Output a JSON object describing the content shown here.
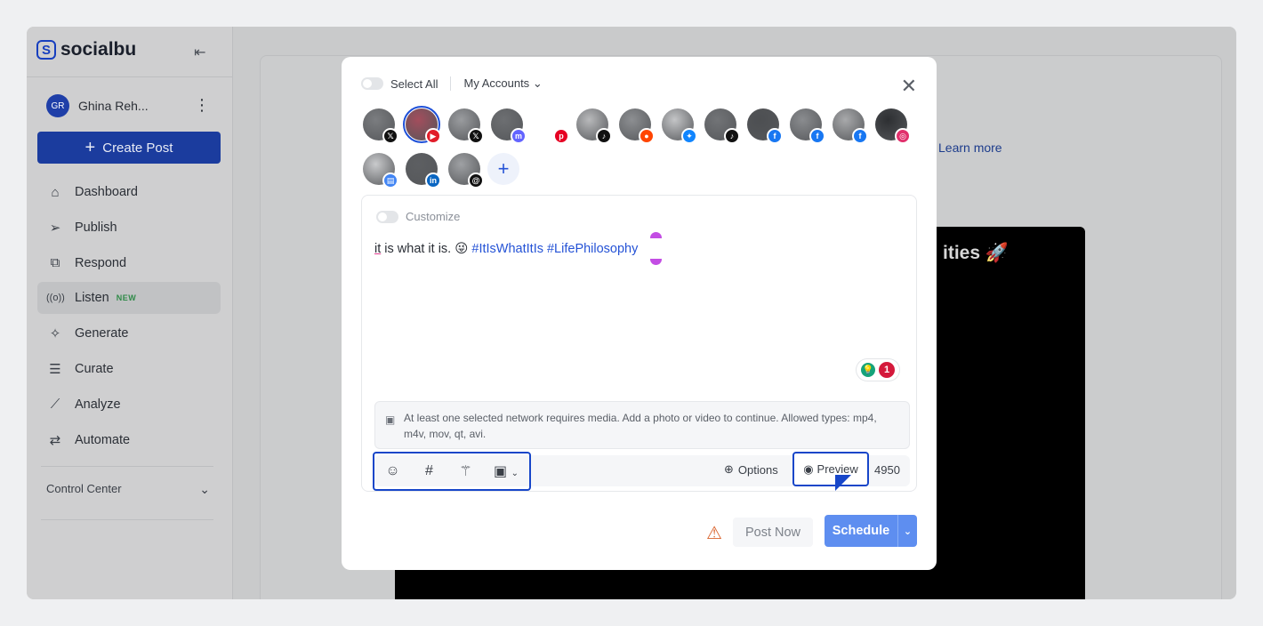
{
  "sidebar": {
    "brand": "socialbu",
    "user": {
      "initials": "GR",
      "name": "Ghina Reh..."
    },
    "create_post_label": "Create Post",
    "items": [
      {
        "label": "Dashboard",
        "icon": "home-icon"
      },
      {
        "label": "Publish",
        "icon": "send-icon"
      },
      {
        "label": "Respond",
        "icon": "inbox-icon"
      },
      {
        "label": "Listen",
        "icon": "broadcast-icon",
        "badge": "NEW",
        "active": true
      },
      {
        "label": "Generate",
        "icon": "sparkle-icon"
      },
      {
        "label": "Curate",
        "icon": "filter-search-icon"
      },
      {
        "label": "Analyze",
        "icon": "chart-line-icon"
      },
      {
        "label": "Automate",
        "icon": "repeat-icon"
      }
    ],
    "control_center_label": "Control Center"
  },
  "background": {
    "learn_more": "Learn more",
    "partial_heading": "ities 🚀"
  },
  "modal": {
    "select_all_label": "Select All",
    "accounts_dropdown_label": "My Accounts",
    "accounts": [
      {
        "network": "x",
        "color": "#111111",
        "glyph": "𝕏"
      },
      {
        "network": "youtube",
        "color": "#e11d2a",
        "glyph": "▶",
        "selected": true
      },
      {
        "network": "x",
        "color": "#111111",
        "glyph": "𝕏"
      },
      {
        "network": "mastodon",
        "color": "#6364ff",
        "glyph": "m"
      },
      {
        "network": "pinterest",
        "color": "#e60023",
        "glyph": "p"
      },
      {
        "network": "tiktok",
        "color": "#111111",
        "glyph": "♪"
      },
      {
        "network": "reddit",
        "color": "#ff4500",
        "glyph": "●"
      },
      {
        "network": "bluesky",
        "color": "#1185fe",
        "glyph": "✦"
      },
      {
        "network": "tiktok",
        "color": "#111111",
        "glyph": "♪"
      },
      {
        "network": "facebook",
        "color": "#1877f2",
        "glyph": "f"
      },
      {
        "network": "facebook",
        "color": "#1877f2",
        "glyph": "f"
      },
      {
        "network": "facebook",
        "color": "#1877f2",
        "glyph": "f"
      },
      {
        "network": "instagram",
        "color": "#e1306c",
        "glyph": "◎"
      },
      {
        "network": "google-business",
        "color": "#4285f4",
        "glyph": "▤"
      },
      {
        "network": "linkedin",
        "color": "#0a66c2",
        "glyph": "in"
      },
      {
        "network": "threads",
        "color": "#111111",
        "glyph": "@"
      }
    ],
    "customize_label": "Customize",
    "post": {
      "word_first": "it",
      "text_rest": " is what it is. 😜 ",
      "hashtags": "#ItIsWhatItIs #LifePhilosophy"
    },
    "grammar_issue_count": "1",
    "media_notice": "At least one selected network requires media. Add a photo or video to continue. Allowed types: mp4, m4v, mov, qt, avi.",
    "options_label": "Options",
    "preview_label": "Preview",
    "char_count": "4950",
    "post_now_label": "Post Now",
    "schedule_label": "Schedule"
  }
}
